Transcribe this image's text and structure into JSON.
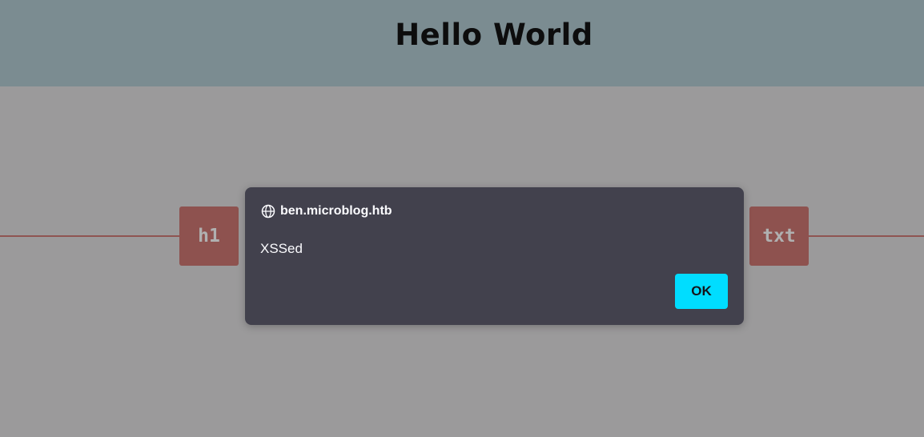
{
  "page": {
    "title": "Hello World"
  },
  "blocks": {
    "left_label": "h1",
    "right_label": "txt"
  },
  "dialog": {
    "origin_icon": "globe-icon",
    "origin": "ben.microblog.htb",
    "message": "XSSed",
    "ok_label": "OK"
  },
  "colors": {
    "header_bg": "#7b8c91",
    "page_bg": "#9b9a9b",
    "block_bg": "#8e524f",
    "dialog_bg": "#42414d",
    "button_bg": "#00ddff"
  }
}
